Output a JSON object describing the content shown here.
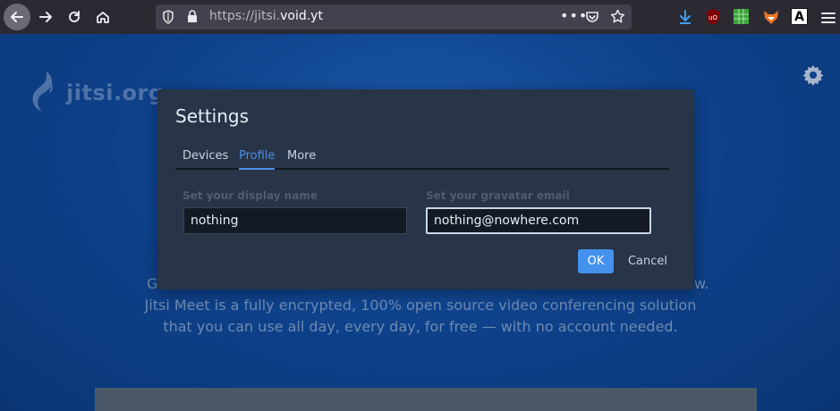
{
  "browser": {
    "url_prefix": "https://jitsi.",
    "url_host": "void.yt",
    "menu_dots": "•••",
    "font_ext_label": "A"
  },
  "page": {
    "logo_text": "jitsi.org",
    "description_clip_left": "G",
    "description_clip_right": "w.",
    "description_line1": "Jitsi Meet is a fully encrypted, 100% open source video conferencing solution",
    "description_line2": "that you can use all day, every day, for free — with no account needed."
  },
  "settings": {
    "title": "Settings",
    "tabs": [
      {
        "label": "Devices",
        "active": false
      },
      {
        "label": "Profile",
        "active": true
      },
      {
        "label": "More",
        "active": false
      }
    ],
    "display_name_label": "Set your display name",
    "display_name_value": "nothing",
    "gravatar_label": "Set your gravatar email",
    "gravatar_value": "nothing@nowhere.com",
    "ok_label": "OK",
    "cancel_label": "Cancel"
  },
  "colors": {
    "accent": "#4592ee",
    "page_bg": "#0b3a7c",
    "modal_bg": "#283447"
  }
}
